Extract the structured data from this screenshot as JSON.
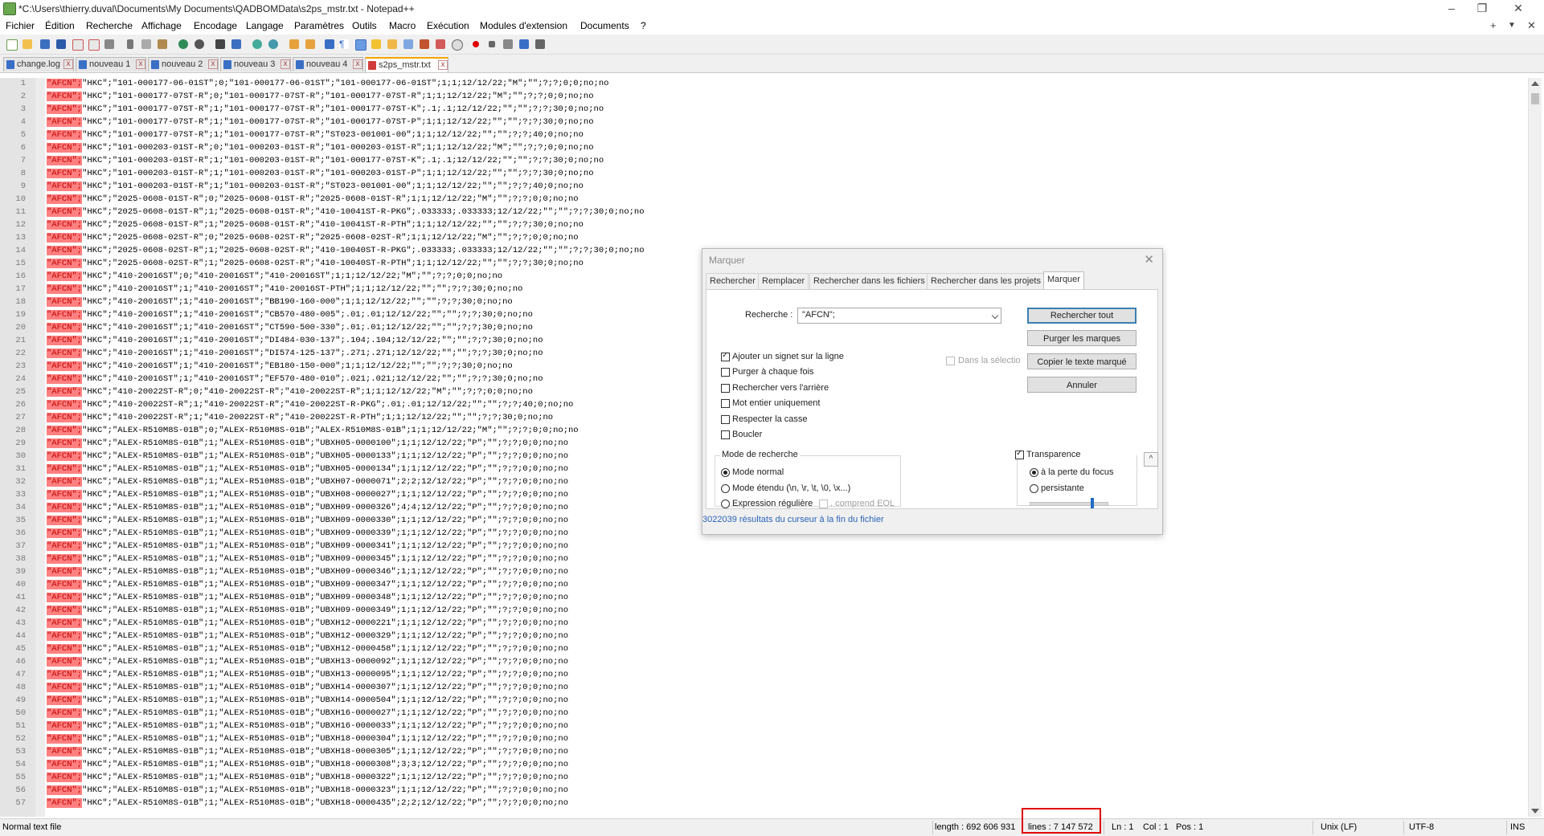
{
  "window": {
    "title": "*C:\\Users\\thierry.duval\\Documents\\My Documents\\QADBOMData\\s2ps_mstr.txt - Notepad++",
    "minimize": "–",
    "restore": "❐",
    "close": "✕"
  },
  "menu": {
    "items": [
      "Fichier",
      "Édition",
      "Recherche",
      "Affichage",
      "Encodage",
      "Langage",
      "Paramètres",
      "Outils",
      "Macro",
      "Exécution",
      "Modules d'extension",
      "Documents",
      "?"
    ],
    "right": [
      "+",
      "▼",
      "✕"
    ]
  },
  "tabs": [
    {
      "label": "change.log",
      "active": false
    },
    {
      "label": "nouveau 1",
      "active": false
    },
    {
      "label": "nouveau 2",
      "active": false
    },
    {
      "label": "nouveau 3",
      "active": false
    },
    {
      "label": "nouveau 4",
      "active": false
    },
    {
      "label": "s2ps_mstr.txt",
      "active": true
    }
  ],
  "editor": {
    "highlight_token": "\"AFCN\";",
    "lines": [
      {
        "n": "1",
        "rest": "\"HKC\";\"101-000177-06-01ST\";0;\"101-000177-06-01ST\";\"101-000177-06-01ST\";1;1;12/12/22;\"M\";\"\";?;?;0;0;no;no"
      },
      {
        "n": "2",
        "rest": "\"HKC\";\"101-000177-07ST-R\";0;\"101-000177-07ST-R\";\"101-000177-07ST-R\";1;1;12/12/22;\"M\";\"\";?;?;0;0;no;no"
      },
      {
        "n": "3",
        "rest": "\"HKC\";\"101-000177-07ST-R\";1;\"101-000177-07ST-R\";\"101-000177-07ST-K\";.1;.1;12/12/22;\"\";\"\";?;?;30;0;no;no"
      },
      {
        "n": "4",
        "rest": "\"HKC\";\"101-000177-07ST-R\";1;\"101-000177-07ST-R\";\"101-000177-07ST-P\";1;1;12/12/22;\"\";\"\";?;?;30;0;no;no"
      },
      {
        "n": "5",
        "rest": "\"HKC\";\"101-000177-07ST-R\";1;\"101-000177-07ST-R\";\"ST023-001001-00\";1;1;12/12/22;\"\";\"\";?;?;40;0;no;no"
      },
      {
        "n": "6",
        "rest": "\"HKC\";\"101-000203-01ST-R\";0;\"101-000203-01ST-R\";\"101-000203-01ST-R\";1;1;12/12/22;\"M\";\"\";?;?;0;0;no;no"
      },
      {
        "n": "7",
        "rest": "\"HKC\";\"101-000203-01ST-R\";1;\"101-000203-01ST-R\";\"101-000177-07ST-K\";.1;.1;12/12/22;\"\";\"\";?;?;30;0;no;no"
      },
      {
        "n": "8",
        "rest": "\"HKC\";\"101-000203-01ST-R\";1;\"101-000203-01ST-R\";\"101-000203-01ST-P\";1;1;12/12/22;\"\";\"\";?;?;30;0;no;no"
      },
      {
        "n": "9",
        "rest": "\"HKC\";\"101-000203-01ST-R\";1;\"101-000203-01ST-R\";\"ST023-001001-00\";1;1;12/12/22;\"\";\"\";?;?;40;0;no;no"
      },
      {
        "n": "10",
        "rest": "\"HKC\";\"2025-0608-01ST-R\";0;\"2025-0608-01ST-R\";\"2025-0608-01ST-R\";1;1;12/12/22;\"M\";\"\";?;?;0;0;no;no"
      },
      {
        "n": "11",
        "rest": "\"HKC\";\"2025-0608-01ST-R\";1;\"2025-0608-01ST-R\";\"410-10041ST-R-PKG\";.033333;.033333;12/12/22;\"\";\"\";?;?;30;0;no;no"
      },
      {
        "n": "12",
        "rest": "\"HKC\";\"2025-0608-01ST-R\";1;\"2025-0608-01ST-R\";\"410-10041ST-R-PTH\";1;1;12/12/22;\"\";\"\";?;?;30;0;no;no"
      },
      {
        "n": "13",
        "rest": "\"HKC\";\"2025-0608-02ST-R\";0;\"2025-0608-02ST-R\";\"2025-0608-02ST-R\";1;1;12/12/22;\"M\";\"\";?;?;0;0;no;no"
      },
      {
        "n": "14",
        "rest": "\"HKC\";\"2025-0608-02ST-R\";1;\"2025-0608-02ST-R\";\"410-10040ST-R-PKG\";.033333;.033333;12/12/22;\"\";\"\";?;?;30;0;no;no"
      },
      {
        "n": "15",
        "rest": "\"HKC\";\"2025-0608-02ST-R\";1;\"2025-0608-02ST-R\";\"410-10040ST-R-PTH\";1;1;12/12/22;\"\";\"\";?;?;30;0;no;no"
      },
      {
        "n": "16",
        "rest": "\"HKC\";\"410-20016ST\";0;\"410-20016ST\";\"410-20016ST\";1;1;12/12/22;\"M\";\"\";?;?;0;0;no;no"
      },
      {
        "n": "17",
        "rest": "\"HKC\";\"410-20016ST\";1;\"410-20016ST\";\"410-20016ST-PTH\";1;1;12/12/22;\"\";\"\";?;?;30;0;no;no"
      },
      {
        "n": "18",
        "rest": "\"HKC\";\"410-20016ST\";1;\"410-20016ST\";\"BB190-160-000\";1;1;12/12/22;\"\";\"\";?;?;30;0;no;no"
      },
      {
        "n": "19",
        "rest": "\"HKC\";\"410-20016ST\";1;\"410-20016ST\";\"CB570-480-005\";.01;.01;12/12/22;\"\";\"\";?;?;30;0;no;no"
      },
      {
        "n": "20",
        "rest": "\"HKC\";\"410-20016ST\";1;\"410-20016ST\";\"CT590-500-330\";.01;.01;12/12/22;\"\";\"\";?;?;30;0;no;no"
      },
      {
        "n": "21",
        "rest": "\"HKC\";\"410-20016ST\";1;\"410-20016ST\";\"DI484-030-137\";.104;.104;12/12/22;\"\";\"\";?;?;30;0;no;no"
      },
      {
        "n": "22",
        "rest": "\"HKC\";\"410-20016ST\";1;\"410-20016ST\";\"DI574-125-137\";.271;.271;12/12/22;\"\";\"\";?;?;30;0;no;no"
      },
      {
        "n": "23",
        "rest": "\"HKC\";\"410-20016ST\";1;\"410-20016ST\";\"EB180-150-000\";1;1;12/12/22;\"\";\"\";?;?;30;0;no;no"
      },
      {
        "n": "24",
        "rest": "\"HKC\";\"410-20016ST\";1;\"410-20016ST\";\"EF570-480-010\";.021;.021;12/12/22;\"\";\"\";?;?;30;0;no;no"
      },
      {
        "n": "25",
        "rest": "\"HKC\";\"410-20022ST-R\";0;\"410-20022ST-R\";\"410-20022ST-R\";1;1;12/12/22;\"M\";\"\";?;?;0;0;no;no"
      },
      {
        "n": "26",
        "rest": "\"HKC\";\"410-20022ST-R\";1;\"410-20022ST-R\";\"410-20022ST-R-PKG\";.01;.01;12/12/22;\"\";\"\";?;?;40;0;no;no"
      },
      {
        "n": "27",
        "rest": "\"HKC\";\"410-20022ST-R\";1;\"410-20022ST-R\";\"410-20022ST-R-PTH\";1;1;12/12/22;\"\";\"\";?;?;30;0;no;no"
      },
      {
        "n": "28",
        "rest": "\"HKC\";\"ALEX-R510M8S-01B\";0;\"ALEX-R510M8S-01B\";\"ALEX-R510M8S-01B\";1;1;12/12/22;\"M\";\"\";?;?;0;0;no;no"
      },
      {
        "n": "29",
        "rest": "\"HKC\";\"ALEX-R510M8S-01B\";1;\"ALEX-R510M8S-01B\";\"UBXH05-0000100\";1;1;12/12/22;\"P\";\"\";?;?;0;0;no;no"
      },
      {
        "n": "30",
        "rest": "\"HKC\";\"ALEX-R510M8S-01B\";1;\"ALEX-R510M8S-01B\";\"UBXH05-0000133\";1;1;12/12/22;\"P\";\"\";?;?;0;0;no;no"
      },
      {
        "n": "31",
        "rest": "\"HKC\";\"ALEX-R510M8S-01B\";1;\"ALEX-R510M8S-01B\";\"UBXH05-0000134\";1;1;12/12/22;\"P\";\"\";?;?;0;0;no;no"
      },
      {
        "n": "32",
        "rest": "\"HKC\";\"ALEX-R510M8S-01B\";1;\"ALEX-R510M8S-01B\";\"UBXH07-0000071\";2;2;12/12/22;\"P\";\"\";?;?;0;0;no;no"
      },
      {
        "n": "33",
        "rest": "\"HKC\";\"ALEX-R510M8S-01B\";1;\"ALEX-R510M8S-01B\";\"UBXH08-0000027\";1;1;12/12/22;\"P\";\"\";?;?;0;0;no;no"
      },
      {
        "n": "34",
        "rest": "\"HKC\";\"ALEX-R510M8S-01B\";1;\"ALEX-R510M8S-01B\";\"UBXH09-0000326\";4;4;12/12/22;\"P\";\"\";?;?;0;0;no;no"
      },
      {
        "n": "35",
        "rest": "\"HKC\";\"ALEX-R510M8S-01B\";1;\"ALEX-R510M8S-01B\";\"UBXH09-0000330\";1;1;12/12/22;\"P\";\"\";?;?;0;0;no;no"
      },
      {
        "n": "36",
        "rest": "\"HKC\";\"ALEX-R510M8S-01B\";1;\"ALEX-R510M8S-01B\";\"UBXH09-0000339\";1;1;12/12/22;\"P\";\"\";?;?;0;0;no;no"
      },
      {
        "n": "37",
        "rest": "\"HKC\";\"ALEX-R510M8S-01B\";1;\"ALEX-R510M8S-01B\";\"UBXH09-0000341\";1;1;12/12/22;\"P\";\"\";?;?;0;0;no;no"
      },
      {
        "n": "38",
        "rest": "\"HKC\";\"ALEX-R510M8S-01B\";1;\"ALEX-R510M8S-01B\";\"UBXH09-0000345\";1;1;12/12/22;\"P\";\"\";?;?;0;0;no;no"
      },
      {
        "n": "39",
        "rest": "\"HKC\";\"ALEX-R510M8S-01B\";1;\"ALEX-R510M8S-01B\";\"UBXH09-0000346\";1;1;12/12/22;\"P\";\"\";?;?;0;0;no;no"
      },
      {
        "n": "40",
        "rest": "\"HKC\";\"ALEX-R510M8S-01B\";1;\"ALEX-R510M8S-01B\";\"UBXH09-0000347\";1;1;12/12/22;\"P\";\"\";?;?;0;0;no;no"
      },
      {
        "n": "41",
        "rest": "\"HKC\";\"ALEX-R510M8S-01B\";1;\"ALEX-R510M8S-01B\";\"UBXH09-0000348\";1;1;12/12/22;\"P\";\"\";?;?;0;0;no;no"
      },
      {
        "n": "42",
        "rest": "\"HKC\";\"ALEX-R510M8S-01B\";1;\"ALEX-R510M8S-01B\";\"UBXH09-0000349\";1;1;12/12/22;\"P\";\"\";?;?;0;0;no;no"
      },
      {
        "n": "43",
        "rest": "\"HKC\";\"ALEX-R510M8S-01B\";1;\"ALEX-R510M8S-01B\";\"UBXH12-0000221\";1;1;12/12/22;\"P\";\"\";?;?;0;0;no;no"
      },
      {
        "n": "44",
        "rest": "\"HKC\";\"ALEX-R510M8S-01B\";1;\"ALEX-R510M8S-01B\";\"UBXH12-0000329\";1;1;12/12/22;\"P\";\"\";?;?;0;0;no;no"
      },
      {
        "n": "45",
        "rest": "\"HKC\";\"ALEX-R510M8S-01B\";1;\"ALEX-R510M8S-01B\";\"UBXH12-0000458\";1;1;12/12/22;\"P\";\"\";?;?;0;0;no;no"
      },
      {
        "n": "46",
        "rest": "\"HKC\";\"ALEX-R510M8S-01B\";1;\"ALEX-R510M8S-01B\";\"UBXH13-0000092\";1;1;12/12/22;\"P\";\"\";?;?;0;0;no;no"
      },
      {
        "n": "47",
        "rest": "\"HKC\";\"ALEX-R510M8S-01B\";1;\"ALEX-R510M8S-01B\";\"UBXH13-0000095\";1;1;12/12/22;\"P\";\"\";?;?;0;0;no;no"
      },
      {
        "n": "48",
        "rest": "\"HKC\";\"ALEX-R510M8S-01B\";1;\"ALEX-R510M8S-01B\";\"UBXH14-0000307\";1;1;12/12/22;\"P\";\"\";?;?;0;0;no;no"
      },
      {
        "n": "49",
        "rest": "\"HKC\";\"ALEX-R510M8S-01B\";1;\"ALEX-R510M8S-01B\";\"UBXH14-0000504\";1;1;12/12/22;\"P\";\"\";?;?;0;0;no;no"
      },
      {
        "n": "50",
        "rest": "\"HKC\";\"ALEX-R510M8S-01B\";1;\"ALEX-R510M8S-01B\";\"UBXH16-0000027\";1;1;12/12/22;\"P\";\"\";?;?;0;0;no;no"
      },
      {
        "n": "51",
        "rest": "\"HKC\";\"ALEX-R510M8S-01B\";1;\"ALEX-R510M8S-01B\";\"UBXH16-0000033\";1;1;12/12/22;\"P\";\"\";?;?;0;0;no;no"
      },
      {
        "n": "52",
        "rest": "\"HKC\";\"ALEX-R510M8S-01B\";1;\"ALEX-R510M8S-01B\";\"UBXH18-0000304\";1;1;12/12/22;\"P\";\"\";?;?;0;0;no;no"
      },
      {
        "n": "53",
        "rest": "\"HKC\";\"ALEX-R510M8S-01B\";1;\"ALEX-R510M8S-01B\";\"UBXH18-0000305\";1;1;12/12/22;\"P\";\"\";?;?;0;0;no;no"
      },
      {
        "n": "54",
        "rest": "\"HKC\";\"ALEX-R510M8S-01B\";1;\"ALEX-R510M8S-01B\";\"UBXH18-0000308\";3;3;12/12/22;\"P\";\"\";?;?;0;0;no;no"
      },
      {
        "n": "55",
        "rest": "\"HKC\";\"ALEX-R510M8S-01B\";1;\"ALEX-R510M8S-01B\";\"UBXH18-0000322\";1;1;12/12/22;\"P\";\"\";?;?;0;0;no;no"
      },
      {
        "n": "56",
        "rest": "\"HKC\";\"ALEX-R510M8S-01B\";1;\"ALEX-R510M8S-01B\";\"UBXH18-0000323\";1;1;12/12/22;\"P\";\"\";?;?;0;0;no;no"
      },
      {
        "n": "57",
        "rest": "\"HKC\";\"ALEX-R510M8S-01B\";1;\"ALEX-R510M8S-01B\";\"UBXH18-0000435\";2;2;12/12/22;\"P\";\"\";?;?;0;0;no;no"
      }
    ]
  },
  "dialog": {
    "title": "Marquer",
    "close": "✕",
    "tabs": [
      "Rechercher",
      "Remplacer",
      "Rechercher dans les fichiers",
      "Rechercher dans les projets",
      "Marquer"
    ],
    "search_label": "Recherche :",
    "search_value": "\"AFCN\";",
    "buttons": {
      "find_all": "Rechercher tout",
      "clear_marks": "Purger les marques",
      "copy_marked": "Copier le texte marqué",
      "cancel": "Annuler"
    },
    "in_selection": "Dans la sélectio",
    "options": [
      {
        "label": "Ajouter un signet sur la ligne",
        "checked": true
      },
      {
        "label": "Purger à chaque fois",
        "checked": false
      },
      {
        "label": "Rechercher vers l'arrière",
        "checked": false
      },
      {
        "label": "Mot entier uniquement",
        "checked": false
      },
      {
        "label": "Respecter la casse",
        "checked": false
      },
      {
        "label": "Boucler",
        "checked": false
      }
    ],
    "search_mode": {
      "title": "Mode de recherche",
      "normal": "Mode normal",
      "extended": "Mode étendu (\\n, \\r, \\t, \\0, \\x...)",
      "regex": "Expression régulière",
      "eol": ". comprend EOL"
    },
    "transparency": {
      "label": "Transparence",
      "checked": true,
      "on_focus_loss": "à la perte du focus",
      "always": "persistante",
      "level": 0.82
    },
    "collapse": "^",
    "status": "3022039 résultats du curseur à la fin du fichier"
  },
  "status_bar": {
    "file_type": "Normal text file",
    "length": "length : 692 606 931",
    "lines": "lines : 7 147 572",
    "ln": "Ln : 1",
    "col": "Col : 1",
    "pos": "Pos : 1",
    "eol": "Unix (LF)",
    "encoding": "UTF-8",
    "insert": "INS"
  },
  "colors": {
    "mark_bg": "#ff8080",
    "mark_fg": "#c00000",
    "active_tab_accent": "#f7a400",
    "callout": "#e00000",
    "link_text": "#2a63b8"
  }
}
